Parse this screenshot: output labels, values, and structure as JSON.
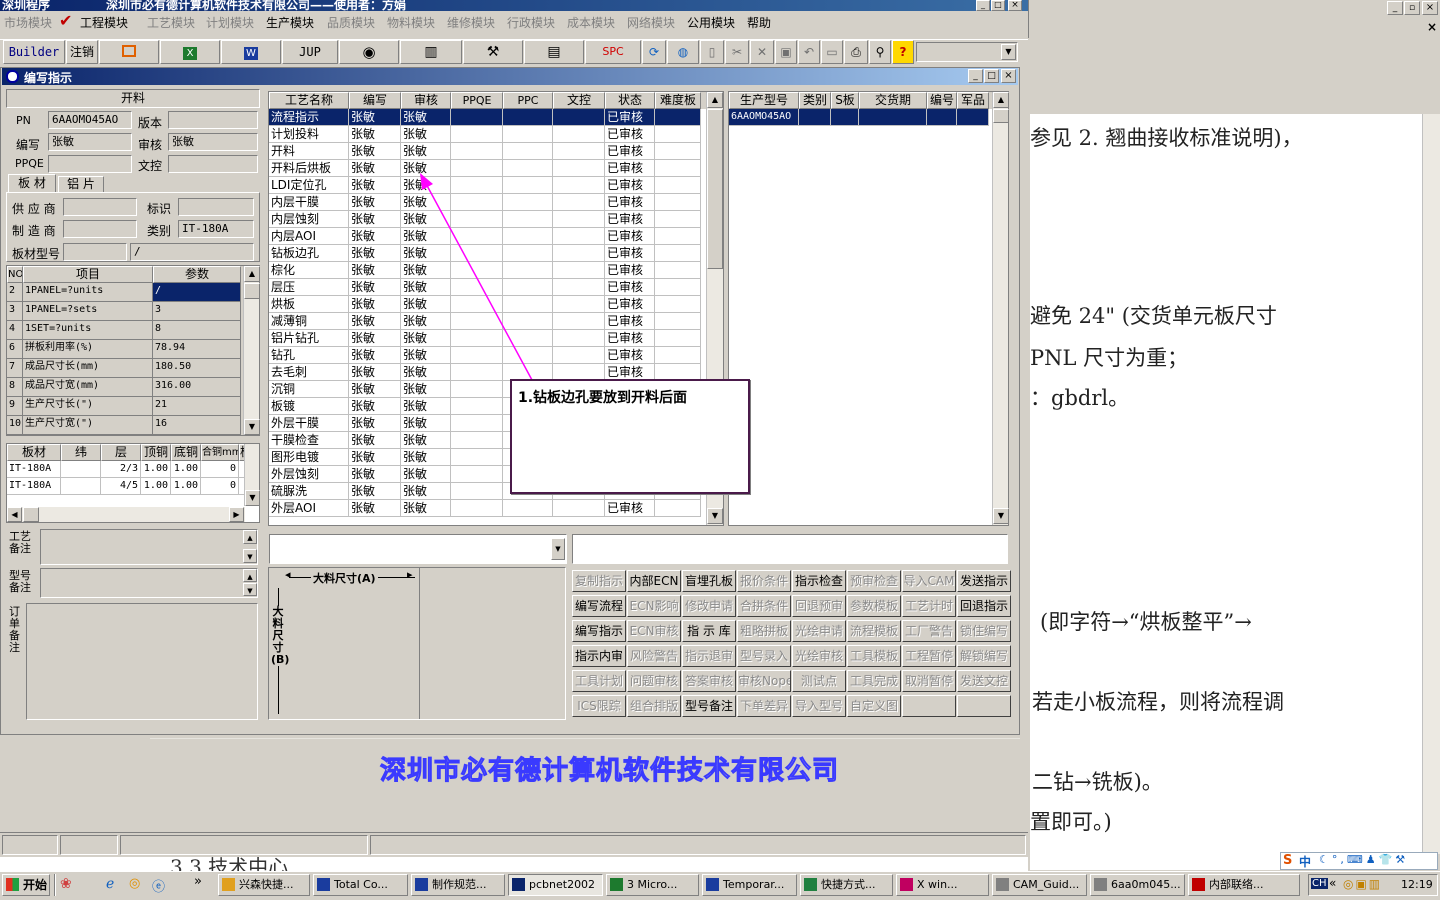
{
  "app": {
    "title_left": "深圳程序",
    "title_main": "深圳市必有德计算机软件技术有限公司——使用者：方娟"
  },
  "menu": [
    "市场模块",
    "工程模块",
    "工艺模块",
    "计划模块",
    "生产模块",
    "品质模块",
    "物料模块",
    "维修模块",
    "行政模块",
    "成本模块",
    "网络模块",
    "公用模块",
    "帮助"
  ],
  "toolbar": {
    "builder": "Builder",
    "logout": "注销",
    "jup": "JUP",
    "spc": "SPC"
  },
  "child_window": {
    "title": "编写指示"
  },
  "left_panel": {
    "header": "开料",
    "pn_label": "PN",
    "pn_value": "6AAOMO45AO",
    "version_label": "版本",
    "version_value": "",
    "writer_label": "编写",
    "writer_value": "张敏",
    "reviewer_label": "审核",
    "reviewer_value": "张敏",
    "ppqe_label": "PPQE",
    "ppqe_value": "",
    "doc_control_label": "文控",
    "doc_control_value": "",
    "tabs": [
      "板 材",
      "铝 片"
    ],
    "supplier_label": "供 应 商",
    "supplier_value": "",
    "mark_label": "标识",
    "mark_value": "",
    "maker_label": "制 造 商",
    "maker_value": "",
    "category_label": "类别",
    "category_value": "IT-180A",
    "board_model_label": "板材型号",
    "board_model_value": "",
    "board_model_value2": "/"
  },
  "params_table": {
    "headers": [
      "NO",
      "项目",
      "参数"
    ],
    "rows": [
      [
        "2",
        "1PANEL=?units",
        "/"
      ],
      [
        "3",
        "1PANEL=?sets",
        "3"
      ],
      [
        "4",
        "1SET=?units",
        "8"
      ],
      [
        "6",
        "拼板利用率(%)",
        "78.94"
      ],
      [
        "7",
        "成品尺寸长(mm)",
        "180.50"
      ],
      [
        "8",
        "成品尺寸宽(mm)",
        "316.00"
      ],
      [
        "9",
        "生产尺寸长(\")",
        "21"
      ],
      [
        "10",
        "生产尺寸宽(\")",
        "16"
      ]
    ]
  },
  "material_table": {
    "headers": [
      "板材",
      "纬",
      "层",
      "顶铜",
      "底铜",
      "合铜mm",
      "板"
    ],
    "rows": [
      [
        "IT-180A",
        "",
        "2/3",
        "1.00",
        "1.00",
        "0",
        ""
      ],
      [
        "IT-180A",
        "",
        "4/5",
        "1.00",
        "1.00",
        "0",
        ""
      ]
    ]
  },
  "notes": {
    "process": "工艺备注",
    "model": "型号备注",
    "order": "订单备注"
  },
  "process_table": {
    "headers": [
      "工艺名称",
      "编写",
      "审核",
      "PPQE",
      "PPC",
      "文控",
      "状态",
      "难度板"
    ],
    "rows": [
      [
        "流程指示",
        "张敏",
        "张敏",
        "",
        "",
        "",
        "已审核",
        ""
      ],
      [
        "计划投料",
        "张敏",
        "张敏",
        "",
        "",
        "",
        "已审核",
        ""
      ],
      [
        "开料",
        "张敏",
        "张敏",
        "",
        "",
        "",
        "已审核",
        ""
      ],
      [
        "开料后烘板",
        "张敏",
        "张敏",
        "",
        "",
        "",
        "已审核",
        ""
      ],
      [
        "LDI定位孔",
        "张敏",
        "张敏",
        "",
        "",
        "",
        "已审核",
        ""
      ],
      [
        "内层干膜",
        "张敏",
        "张敏",
        "",
        "",
        "",
        "已审核",
        ""
      ],
      [
        "内层蚀刻",
        "张敏",
        "张敏",
        "",
        "",
        "",
        "已审核",
        ""
      ],
      [
        "内层AOI",
        "张敏",
        "张敏",
        "",
        "",
        "",
        "已审核",
        ""
      ],
      [
        "钻板边孔",
        "张敏",
        "张敏",
        "",
        "",
        "",
        "已审核",
        ""
      ],
      [
        "棕化",
        "张敏",
        "张敏",
        "",
        "",
        "",
        "已审核",
        ""
      ],
      [
        "层压",
        "张敏",
        "张敏",
        "",
        "",
        "",
        "已审核",
        ""
      ],
      [
        "烘板",
        "张敏",
        "张敏",
        "",
        "",
        "",
        "已审核",
        ""
      ],
      [
        "减薄铜",
        "张敏",
        "张敏",
        "",
        "",
        "",
        "已审核",
        ""
      ],
      [
        "铝片钻孔",
        "张敏",
        "张敏",
        "",
        "",
        "",
        "已审核",
        ""
      ],
      [
        "钻孔",
        "张敏",
        "张敏",
        "",
        "",
        "",
        "已审核",
        ""
      ],
      [
        "去毛刺",
        "张敏",
        "张敏",
        "",
        "",
        "",
        "已审核",
        ""
      ],
      [
        "沉铜",
        "张敏",
        "张敏",
        "",
        "",
        "",
        "",
        ""
      ],
      [
        "板镀",
        "张敏",
        "张敏",
        "",
        "",
        "",
        "",
        ""
      ],
      [
        "外层干膜",
        "张敏",
        "张敏",
        "",
        "",
        "",
        "",
        ""
      ],
      [
        "干膜检查",
        "张敏",
        "张敏",
        "",
        "",
        "",
        "",
        ""
      ],
      [
        "图形电镀",
        "张敏",
        "张敏",
        "",
        "",
        "",
        "",
        ""
      ],
      [
        "外层蚀刻",
        "张敏",
        "张敏",
        "",
        "",
        "",
        "",
        ""
      ],
      [
        "硫脲洗",
        "张敏",
        "张敏",
        "",
        "",
        "",
        "",
        ""
      ],
      [
        "外层AOI",
        "张敏",
        "张敏",
        "",
        "",
        "",
        "已审核",
        ""
      ]
    ]
  },
  "model_table": {
    "headers": [
      "生产型号",
      "类别",
      "S板",
      "交货期",
      "编号",
      "军品"
    ],
    "rows": [
      [
        "6AAOMO45AO",
        "",
        "",
        "",
        "",
        ""
      ]
    ]
  },
  "panel_size": {
    "a_label": "大料尺寸(A)",
    "b_label": "大料尺寸(B)"
  },
  "annotation": {
    "text": "1.钻板边孔要放到开料后面"
  },
  "buttons": [
    [
      "复制指示",
      0
    ],
    [
      "内部ECN",
      1
    ],
    [
      "盲埋孔板",
      1
    ],
    [
      "报价条件",
      0
    ],
    [
      "指示检查",
      1
    ],
    [
      "预审检查",
      0
    ],
    [
      "导入CAM",
      0
    ],
    [
      "发送指示",
      1
    ],
    [
      "编写流程",
      1
    ],
    [
      "ECN影响",
      0
    ],
    [
      "修改申请",
      0
    ],
    [
      "合拼条件",
      0
    ],
    [
      "回退预审",
      0
    ],
    [
      "参数模板",
      0
    ],
    [
      "工艺计时",
      0
    ],
    [
      "回退指示",
      1
    ],
    [
      "编写指示",
      1
    ],
    [
      "ECN审核",
      0
    ],
    [
      "指 示 库",
      1
    ],
    [
      "粗略拼板",
      0
    ],
    [
      "光绘申请",
      0
    ],
    [
      "流程模板",
      0
    ],
    [
      "工厂警告",
      0
    ],
    [
      "锁住编写",
      0
    ],
    [
      "指示内审",
      1
    ],
    [
      "风险警告",
      0
    ],
    [
      "指示退审",
      0
    ],
    [
      "型号录入",
      0
    ],
    [
      "光绘审核",
      0
    ],
    [
      "工具模板",
      0
    ],
    [
      "工程暂停",
      0
    ],
    [
      "解锁编写",
      0
    ],
    [
      "工具计划",
      0
    ],
    [
      "问题审核",
      0
    ],
    [
      "答案审核",
      0
    ],
    [
      "审核Nope",
      0
    ],
    [
      "测试点",
      0
    ],
    [
      "工具完成",
      0
    ],
    [
      "取消暂停",
      0
    ],
    [
      "发送文控",
      0
    ],
    [
      "ICS限踪",
      0
    ],
    [
      "组合排版",
      0
    ],
    [
      "型号备注",
      1
    ],
    [
      "下单差异",
      0
    ],
    [
      "导入型号",
      0
    ],
    [
      "自定义图",
      0
    ],
    [
      "",
      0
    ],
    [
      "",
      0
    ]
  ],
  "watermark": "深圳市必有德计算机软件技术有限公司",
  "document": {
    "lines": [
      "参见 2. 翘曲接收标准说明)，",
      "避免 24\" (交货单元板尺寸",
      "PNL 尺寸为重；",
      "：gbdrl。",
      "(即字符→“烘板整平”→",
      "若走小板流程，则将流程调",
      "二钻→铣板)。",
      "置即可。)"
    ],
    "partial_bottom": "3.3 技术中心"
  },
  "taskbar": {
    "start": "开始",
    "tasks": [
      "兴森快捷...",
      "Total Co...",
      "制作规范...",
      "pcbnet2002",
      "3 Micro...",
      "Temporar...",
      "快捷方式...",
      "X win...",
      "CAM_Guid...",
      "6aa0m045...",
      "内部联络..."
    ],
    "tray_lang": "CH",
    "clock": "12:19",
    "ime": "中"
  },
  "colors": {
    "titlebar": "#0a246a",
    "selection": "#0a246a",
    "annotation_border": "#4a1a4a",
    "arrow": "#ff00ff",
    "watermark": "#3a3aff"
  }
}
